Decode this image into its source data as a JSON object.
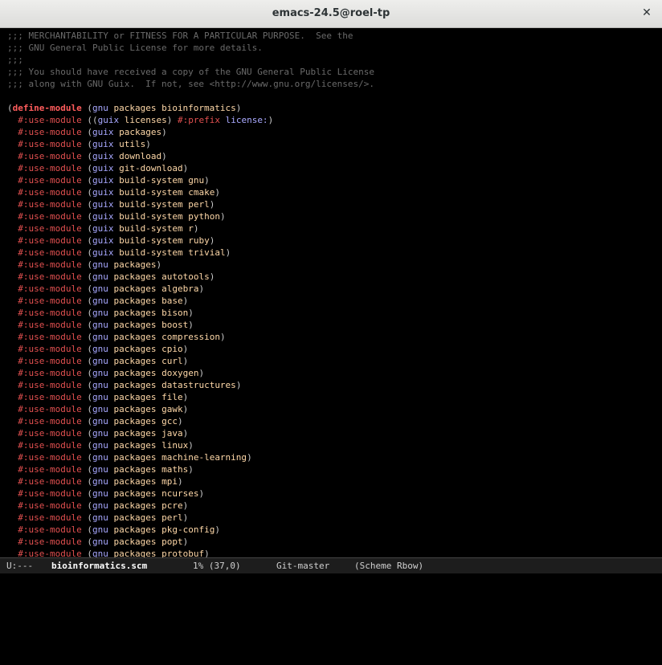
{
  "window": {
    "title": "emacs-24.5@roel-tp"
  },
  "header_comments": [
    ";;; MERCHANTABILITY or FITNESS FOR A PARTICULAR PURPOSE.  See the",
    ";;; GNU General Public License for more details.",
    ";;;",
    ";;; You should have received a copy of the GNU General Public License",
    ";;; along with GNU Guix.  If not, see <http://www.gnu.org/licenses/>."
  ],
  "define": {
    "keyword": "define-module",
    "module": "(gnu packages bioinformatics)",
    "first_use_keyword": "#:use-module",
    "first_use_module": "((guix licenses) #:prefix license:)"
  },
  "use_keyword": "#:use-module",
  "use_modules": [
    [
      "guix",
      "packages"
    ],
    [
      "guix",
      "utils"
    ],
    [
      "guix",
      "download"
    ],
    [
      "guix",
      "git-download"
    ],
    [
      "guix",
      "build-system gnu"
    ],
    [
      "guix",
      "build-system cmake"
    ],
    [
      "guix",
      "build-system perl"
    ],
    [
      "guix",
      "build-system python"
    ],
    [
      "guix",
      "build-system r"
    ],
    [
      "guix",
      "build-system ruby"
    ],
    [
      "guix",
      "build-system trivial"
    ],
    [
      "gnu",
      "packages"
    ],
    [
      "gnu",
      "packages autotools"
    ],
    [
      "gnu",
      "packages algebra"
    ],
    [
      "gnu",
      "packages base"
    ],
    [
      "gnu",
      "packages bison"
    ],
    [
      "gnu",
      "packages boost"
    ],
    [
      "gnu",
      "packages compression"
    ],
    [
      "gnu",
      "packages cpio"
    ],
    [
      "gnu",
      "packages curl"
    ],
    [
      "gnu",
      "packages doxygen"
    ],
    [
      "gnu",
      "packages datastructures"
    ],
    [
      "gnu",
      "packages file"
    ],
    [
      "gnu",
      "packages gawk"
    ],
    [
      "gnu",
      "packages gcc"
    ],
    [
      "gnu",
      "packages java"
    ],
    [
      "gnu",
      "packages linux"
    ],
    [
      "gnu",
      "packages machine-learning"
    ],
    [
      "gnu",
      "packages maths"
    ],
    [
      "gnu",
      "packages mpi"
    ],
    [
      "gnu",
      "packages ncurses"
    ],
    [
      "gnu",
      "packages pcre"
    ],
    [
      "gnu",
      "packages perl"
    ],
    [
      "gnu",
      "packages pkg-config"
    ],
    [
      "gnu",
      "packages popt"
    ],
    [
      "gnu",
      "packages protobuf"
    ]
  ],
  "modeline": {
    "status": "U:---",
    "buffer": "bioinformatics.scm",
    "position": "1% (37,0)",
    "vc": "Git-master",
    "modes": "(Scheme Rbow)"
  },
  "colors": {
    "comment": "#6a6a6a",
    "keyword": "#e25050",
    "define": "#ff5c5c",
    "background": "#000000",
    "modeline_bg": "#1d1d1d"
  }
}
